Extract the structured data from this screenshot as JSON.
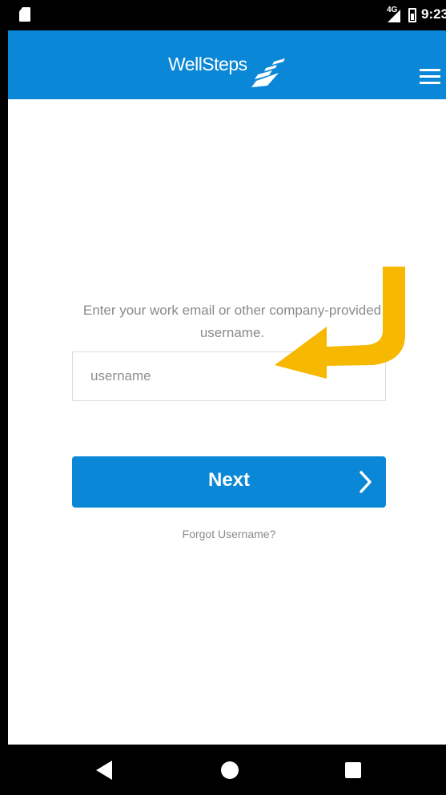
{
  "status_bar": {
    "network": "4G",
    "time": "9:23"
  },
  "header": {
    "logo_text": "WellSteps",
    "menu_icon": "hamburger-menu-icon"
  },
  "login": {
    "prompt": "Enter your work email or other company-provided username.",
    "username_placeholder": "username",
    "username_value": "",
    "next_label": "Next",
    "forgot_label": "Forgot Username?"
  },
  "annotation": {
    "arrow_color": "#f6b800",
    "arrow_icon": "curved-arrow-icon"
  },
  "colors": {
    "brand": "#0a87d6"
  },
  "nav_bar": {
    "back_icon": "back-icon",
    "home_icon": "home-icon",
    "recents_icon": "recents-icon"
  }
}
